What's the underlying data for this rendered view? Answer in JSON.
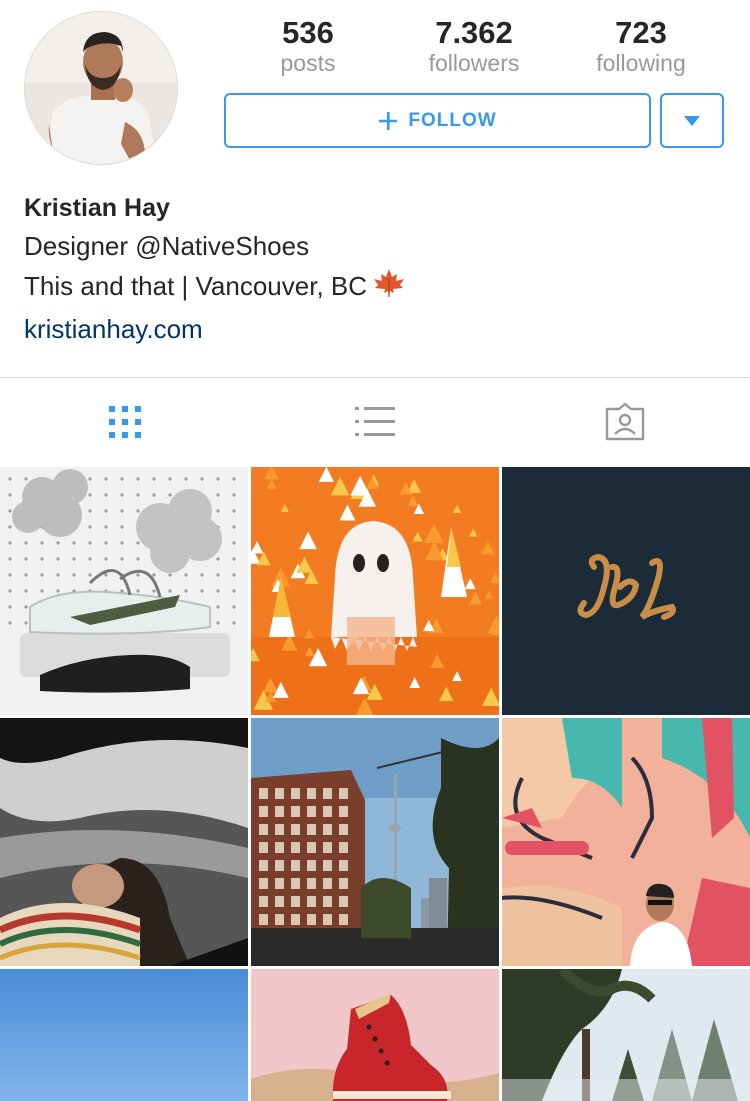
{
  "profile": {
    "name": "Kristian Hay",
    "bio_lines": [
      "Designer @NativeShoes",
      "This and that | Vancouver, BC"
    ],
    "website": "kristianhay.com",
    "leaf_icon": "maple-leaf-emoji"
  },
  "stats": [
    {
      "value": "536",
      "label": "posts"
    },
    {
      "value": "7.362",
      "label": "followers"
    },
    {
      "value": "723",
      "label": "following"
    }
  ],
  "actions": {
    "follow_label": "FOLLOW",
    "follow_icon": "plus-icon",
    "more_icon": "caret-down-icon"
  },
  "tabs": [
    {
      "name": "grid-view",
      "icon": "grid-icon",
      "active": true
    },
    {
      "name": "list-view",
      "icon": "list-icon",
      "active": false
    },
    {
      "name": "tagged-photos",
      "icon": "tagged-icon",
      "active": false
    }
  ],
  "posts": [
    {
      "subject": "shoe-on-pegboard-photo"
    },
    {
      "subject": "candy-corn-ghost-photo"
    },
    {
      "subject": "kh-monogram-photo",
      "text": "KL"
    },
    {
      "subject": "portrait-blanket-photo"
    },
    {
      "subject": "city-street-tower-photo"
    },
    {
      "subject": "mural-selfie-photo"
    },
    {
      "subject": "blue-sky-photo"
    },
    {
      "subject": "red-boot-photo"
    },
    {
      "subject": "forest-trees-photo"
    }
  ],
  "colors": {
    "accent": "#3897f0",
    "link": "#003569",
    "muted": "#999999",
    "text": "#262626",
    "divider": "#dbdbdb"
  }
}
